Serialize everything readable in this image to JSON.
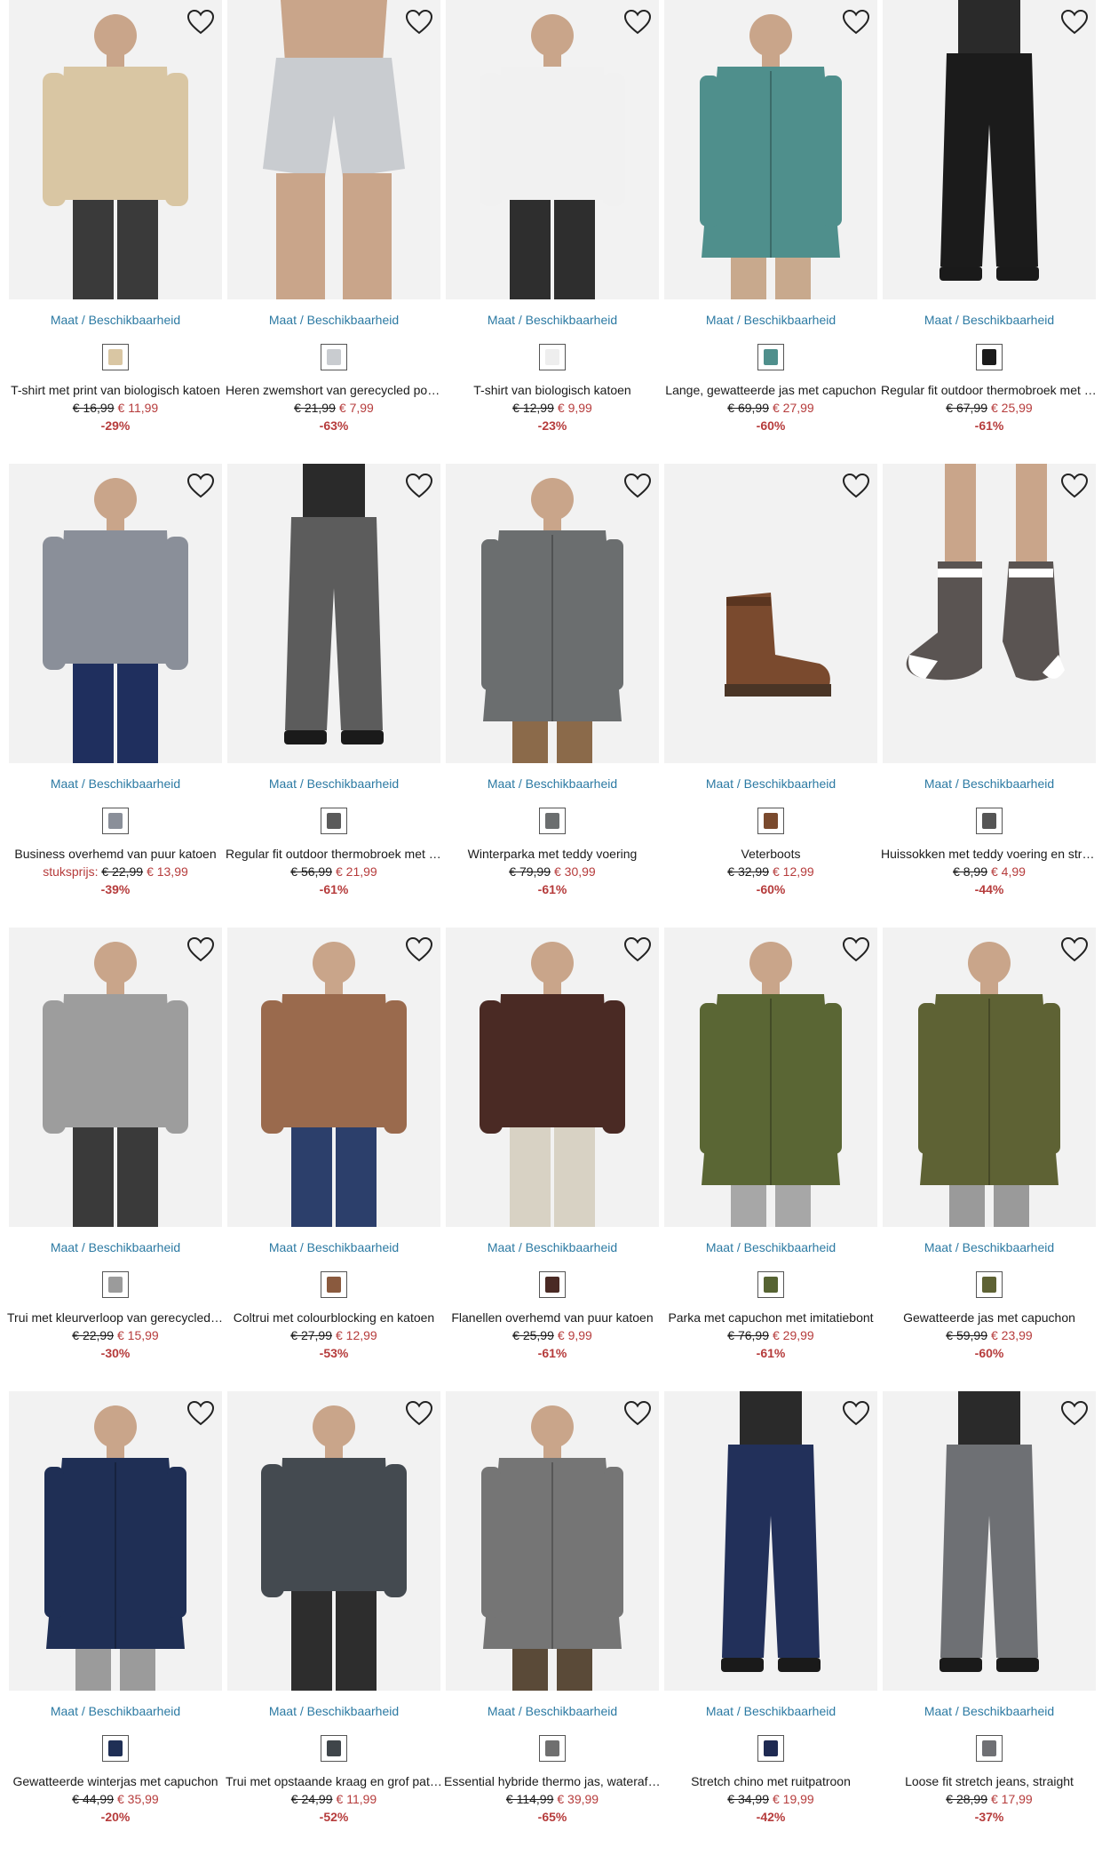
{
  "size_link_label": "Maat / Beschikbaarheid",
  "wishlist_icon": "heart-outline-icon",
  "colors": {
    "link": "#2c7aa3",
    "sale": "#b63c3c",
    "photo_bg": "#f2f2f2"
  },
  "products": [
    {
      "name": "T-shirt met print van biologisch katoen",
      "old_price": "€ 16,99",
      "new_price": "€ 11,99",
      "discount": "-29%",
      "swatch": "#d9c6a3",
      "kind": "top",
      "c1": "#d9c6a3",
      "c2": "#3a3a3a"
    },
    {
      "name": "Heren zwemshort van gerecycled polyester",
      "old_price": "€ 21,99",
      "new_price": "€ 7,99",
      "discount": "-63%",
      "swatch": "#c9ccd0",
      "kind": "shorts",
      "c1": "#c9ccd0",
      "c2": "#d9a98a"
    },
    {
      "name": "T-shirt van biologisch katoen",
      "old_price": "€ 12,99",
      "new_price": "€ 9,99",
      "discount": "-23%",
      "swatch": "#eeeeee",
      "kind": "top",
      "c1": "#f1f1f1",
      "c2": "#2e2e2e"
    },
    {
      "name": "Lange, gewatteerde jas met capuchon",
      "old_price": "€ 69,99",
      "new_price": "€ 27,99",
      "discount": "-60%",
      "swatch": "#4f8f8c",
      "kind": "coat",
      "c1": "#4f8f8c",
      "c2": "#c8a98d"
    },
    {
      "name": "Regular fit outdoor thermobroek met bretels",
      "old_price": "€ 67,99",
      "new_price": "€ 25,99",
      "discount": "-61%",
      "swatch": "#1b1b1b",
      "kind": "pants",
      "c1": "#1b1b1b",
      "c2": "#cfcfcf"
    },
    {
      "name": "Business overhemd van puur katoen",
      "prefix": "stuksprijs:",
      "old_price": "€ 22,99",
      "new_price": "€ 13,99",
      "discount": "-39%",
      "swatch": "#8a8f99",
      "kind": "top",
      "c1": "#8a8f99",
      "c2": "#1f2f5e"
    },
    {
      "name": "Regular fit outdoor thermobroek met bretels",
      "old_price": "€ 56,99",
      "new_price": "€ 21,99",
      "discount": "-61%",
      "swatch": "#5a5a5a",
      "kind": "pants",
      "c1": "#5c5c5c",
      "c2": "#111111"
    },
    {
      "name": "Winterparka met teddy voering",
      "old_price": "€ 79,99",
      "new_price": "€ 30,99",
      "discount": "-61%",
      "swatch": "#6b6e6f",
      "kind": "coat",
      "c1": "#6b6e6f",
      "c2": "#8b6a4a"
    },
    {
      "name": "Veterboots",
      "old_price": "€ 32,99",
      "new_price": "€ 12,99",
      "discount": "-60%",
      "swatch": "#7a4a2e",
      "kind": "boot",
      "c1": "#7a4a2e",
      "c2": "#4a3526"
    },
    {
      "name": "Huissokken met teddy voering en strepen",
      "old_price": "€ 8,99",
      "new_price": "€ 4,99",
      "discount": "-44%",
      "swatch": "#555555",
      "kind": "socks",
      "c1": "#5a5452",
      "c2": "#ffffff"
    },
    {
      "name": "Trui met kleurverloop van gerecycled katoen",
      "old_price": "€ 22,99",
      "new_price": "€ 15,99",
      "discount": "-30%",
      "swatch": "#9b9b9b",
      "kind": "top",
      "c1": "#9d9d9d",
      "c2": "#3a3a3a"
    },
    {
      "name": "Coltrui met colourblocking en katoen",
      "old_price": "€ 27,99",
      "new_price": "€ 12,99",
      "discount": "-53%",
      "swatch": "#8a5a3e",
      "kind": "top",
      "c1": "#9a6a4d",
      "c2": "#2c3f6b"
    },
    {
      "name": "Flanellen overhemd van puur katoen",
      "old_price": "€ 25,99",
      "new_price": "€ 9,99",
      "discount": "-61%",
      "swatch": "#4a2a24",
      "kind": "top",
      "c1": "#4a2a24",
      "c2": "#d8d2c4"
    },
    {
      "name": "Parka met capuchon met imitatiebont",
      "old_price": "€ 76,99",
      "new_price": "€ 29,99",
      "discount": "-61%",
      "swatch": "#566332",
      "kind": "coat",
      "c1": "#5a6634",
      "c2": "#a7a7a7"
    },
    {
      "name": "Gewatteerde jas met capuchon",
      "old_price": "€ 59,99",
      "new_price": "€ 23,99",
      "discount": "-60%",
      "swatch": "#5e6234",
      "kind": "coat",
      "c1": "#5e6234",
      "c2": "#9a9a9a"
    },
    {
      "name": "Gewatteerde winterjas met capuchon",
      "old_price": "€ 44,99",
      "new_price": "€ 35,99",
      "discount": "-20%",
      "swatch": "#1f2f55",
      "kind": "coat",
      "c1": "#1f2f55",
      "c2": "#9b9b9b"
    },
    {
      "name": "Trui met opstaande kraag en grof patroon",
      "old_price": "€ 24,99",
      "new_price": "€ 11,99",
      "discount": "-52%",
      "swatch": "#3f454a",
      "kind": "top",
      "c1": "#444a50",
      "c2": "#2d2d2d"
    },
    {
      "name": "Essential hybride thermo jas, waterafstotend",
      "old_price": "€ 114,99",
      "new_price": "€ 39,99",
      "discount": "-65%",
      "swatch": "#6f6f6f",
      "kind": "coat",
      "c1": "#757575",
      "c2": "#5a4a38"
    },
    {
      "name": "Stretch chino met ruitpatroon",
      "old_price": "€ 34,99",
      "new_price": "€ 19,99",
      "discount": "-42%",
      "swatch": "#1e2a52",
      "kind": "pants",
      "c1": "#22305a",
      "c2": "#1a1a1a"
    },
    {
      "name": "Loose fit stretch jeans, straight",
      "old_price": "€ 28,99",
      "new_price": "€ 17,99",
      "discount": "-37%",
      "swatch": "#6f7074",
      "kind": "pants",
      "c1": "#6e7074",
      "c2": "#e8e8e8"
    }
  ]
}
